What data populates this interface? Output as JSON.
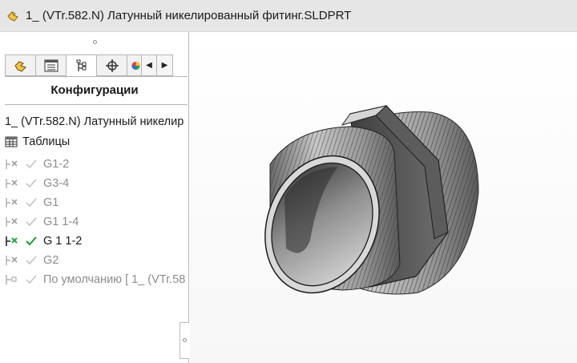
{
  "window": {
    "title": "1_ (VTr.582.N) Латунный никелированный фитинг.SLDPRT"
  },
  "panel": {
    "heading": "Конфигурации",
    "tabs": [
      "feature-manager",
      "property-manager",
      "configuration-manager",
      "dimxpert-manager",
      "display-manager"
    ],
    "root_item": "1_ (VTr.582.N) Латунный никелир",
    "tables_item": "Таблицы",
    "configurations": [
      {
        "label": "G1-2",
        "active": false
      },
      {
        "label": "G3-4",
        "active": false
      },
      {
        "label": "G1",
        "active": false
      },
      {
        "label": "G1 1-4",
        "active": false
      },
      {
        "label": "G 1 1-2",
        "active": true
      },
      {
        "label": "G2",
        "active": false
      },
      {
        "label": "По умолчанию [ 1_ (VTr.58",
        "active": false
      }
    ]
  },
  "colors": {
    "active_check": "#1a9e2e",
    "inactive_check": "#c8c8c8",
    "active_x": "#1a9e2e"
  }
}
